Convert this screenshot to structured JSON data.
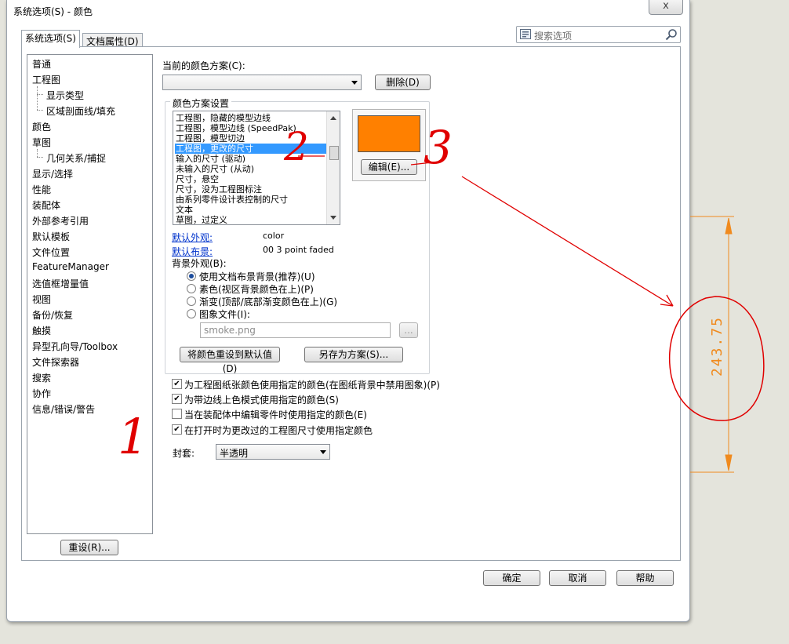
{
  "window": {
    "title": "系统选项(S) - 颜色",
    "close_glyph": "x"
  },
  "tabs": [
    {
      "label": "系统选项(S)"
    },
    {
      "label": "文档属性(D)"
    }
  ],
  "search": {
    "placeholder": "搜索选项"
  },
  "nav": {
    "items": [
      "普通",
      "工程图",
      "显示类型",
      "区域剖面线/填充",
      "颜色",
      "草图",
      "几何关系/捕捉",
      "显示/选择",
      "性能",
      "装配体",
      "外部参考引用",
      "默认模板",
      "文件位置",
      "FeatureManager",
      "选值框增量值",
      "视图",
      "备份/恢复",
      "触摸",
      "异型孔向导/Toolbox",
      "文件探索器",
      "搜索",
      "协作",
      "信息/错误/警告"
    ],
    "reset_label": "重设(R)..."
  },
  "scheme": {
    "current_label": "当前的颜色方案(C):",
    "current_value": "",
    "delete_label": "删除(D)",
    "group_label": "颜色方案设置",
    "list_items": [
      "工程图，隐藏的模型边线",
      "工程图，模型边线 (SpeedPak)",
      "工程图，模型切边",
      "工程图，更改的尺寸",
      "输入的尺寸 (驱动)",
      "未输入的尺寸 (从动)",
      "尺寸，悬空",
      "尺寸，没为工程图标注",
      "由系列零件设计表控制的尺寸",
      "文本",
      "草图，过定义"
    ],
    "selected_index": 3,
    "swatch_color": "#ff8000",
    "edit_label": "编辑(E)...",
    "default_appearance_label": "默认外观:",
    "default_appearance_value": "color",
    "default_scene_label": "默认布景:",
    "default_scene_value": "00 3 point faded",
    "bg_label": "背景外观(B):",
    "bg_options": [
      "使用文档布景背景(推荐)(U)",
      "素色(视区背景颜色在上)(P)",
      "渐变(顶部/底部渐变颜色在上)(G)",
      "图象文件(I):"
    ],
    "bg_selected": 0,
    "image_file": "smoke.png",
    "browse_label": "...",
    "reset_colors_label": "将颜色重设到默认值(D)",
    "save_scheme_label": "另存为方案(S)..."
  },
  "checkboxes": [
    {
      "label": "为工程图纸张颜色使用指定的颜色(在图纸背景中禁用图象)(P)",
      "checked": true
    },
    {
      "label": "为带边线上色模式使用指定的颜色(S)",
      "checked": true
    },
    {
      "label": "当在装配体中编辑零件时使用指定的颜色(E)",
      "checked": false
    },
    {
      "label": "在打开时为更改过的工程图尺寸使用指定颜色",
      "checked": true
    }
  ],
  "envelope": {
    "label": "封套:",
    "value": "半透明"
  },
  "footer": {
    "ok": "确定",
    "cancel": "取消",
    "help": "帮助"
  },
  "annotation": {
    "dimension_text": "243.75",
    "dimension_color": "#f08a1e",
    "marker_color": "#e00000",
    "marks": [
      "1",
      "2",
      "3"
    ]
  }
}
